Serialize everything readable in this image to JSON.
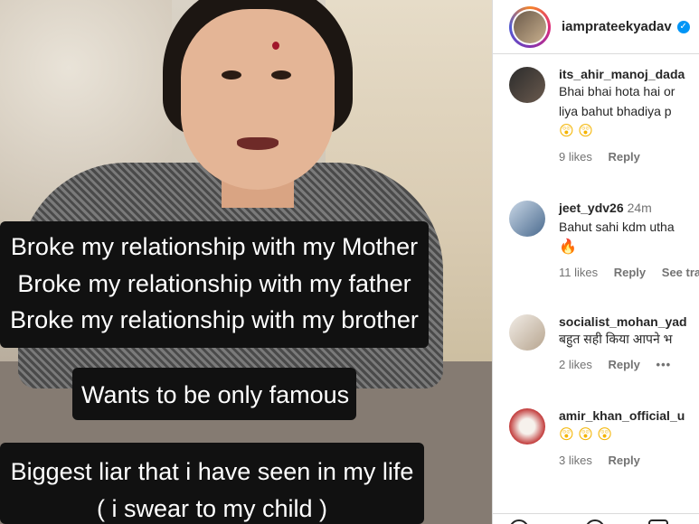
{
  "story": {
    "captions": {
      "block1": [
        "Broke my relationship with my Mother",
        "Broke my relationship with my father",
        "Broke my relationship with my brother"
      ],
      "block2": "Wants to be only famous",
      "block3": [
        "Biggest liar that i have seen in my life",
        "( i swear to my child )"
      ]
    }
  },
  "header": {
    "username": "iamprateekyadav",
    "verified_mark": "✓"
  },
  "comments": [
    {
      "username": "its_ahir_manoj_dada",
      "time": "",
      "lines": [
        "Bhai bhai hota hai or",
        "liya bahut bhadiya p"
      ],
      "emoji": "😲 😲",
      "likes": "9 likes",
      "reply": "Reply",
      "extra": ""
    },
    {
      "username": "jeet_ydv26",
      "time": "24m",
      "lines": [
        "Bahut sahi kdm utha"
      ],
      "emoji": "🔥",
      "likes": "11 likes",
      "reply": "Reply",
      "extra": "See tra"
    },
    {
      "username": "socialist_mohan_yad",
      "time": "",
      "lines": [
        "बहुत सही किया आपने भ"
      ],
      "emoji": "",
      "likes": "2 likes",
      "reply": "Reply",
      "extra": "•••"
    },
    {
      "username": "amir_khan_official_u",
      "time": "",
      "lines": [],
      "emoji": "😲 😲 😲",
      "likes": "3 likes",
      "reply": "Reply",
      "extra": ""
    }
  ],
  "colors": {
    "caption_bg": "#111111",
    "verified": "#0095f6",
    "muted_text": "#737373"
  }
}
